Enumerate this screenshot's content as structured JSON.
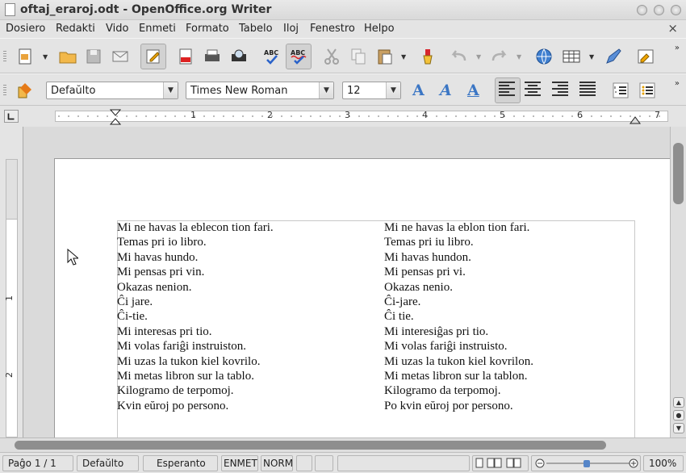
{
  "window": {
    "title": "oftaj_eraroj.odt - OpenOffice.org Writer"
  },
  "menu": {
    "items": [
      "Dosiero",
      "Redakti",
      "Vido",
      "Enmeti",
      "Formato",
      "Tabelo",
      "Iloj",
      "Fenestro",
      "Helpo"
    ],
    "close_symbol": "×"
  },
  "formatting": {
    "paragraph_style": "Defaŭlto",
    "font_name": "Times New Roman",
    "font_size": "12",
    "bold": "A",
    "italic": "A",
    "underline": "A"
  },
  "ruler": {
    "marks": [
      "1",
      "2",
      "3",
      "4",
      "5",
      "6",
      "7"
    ],
    "vertical_marks": [
      "1",
      "2"
    ]
  },
  "document": {
    "left_column": [
      "Mi ne havas la eblecon tion fari.",
      "Temas pri io libro.",
      "Mi havas hundo.",
      "Mi pensas pri vin.",
      "Okazas nenion.",
      "Ĉi jare.",
      "Ĉi-tie.",
      "Mi interesas pri tio.",
      "Mi volas fariĝi instruiston.",
      "Mi uzas la tukon kiel kovrilo.",
      "Mi metas libron sur la tablo.",
      "Kilogramo de terpomoj.",
      "Kvin eŭroj po persono."
    ],
    "right_column": [
      "Mi ne havas la eblon tion fari.",
      "Temas pri iu libro.",
      "Mi havas hundon.",
      "Mi pensas pri vi.",
      "Okazas nenio.",
      "Ĉi-jare.",
      "Ĉi tie.",
      "Mi interesiĝas pri tio.",
      "Mi volas fariĝi instruisto.",
      "Mi uzas la tukon kiel kovrilon.",
      "Mi metas libron sur la tablon.",
      "Kilogramo da terpomoj.",
      "Po kvin eŭroj por persono."
    ]
  },
  "status": {
    "page": "Paĝo 1 / 1",
    "page_style": "Defaŭlto",
    "language": "Esperanto",
    "insert_mode": "ENMET",
    "selection_mode": "NORM",
    "zoom": "100%"
  },
  "colors": {
    "accent": "#3b76c4",
    "spellcheck_underline": "#3050c8"
  }
}
